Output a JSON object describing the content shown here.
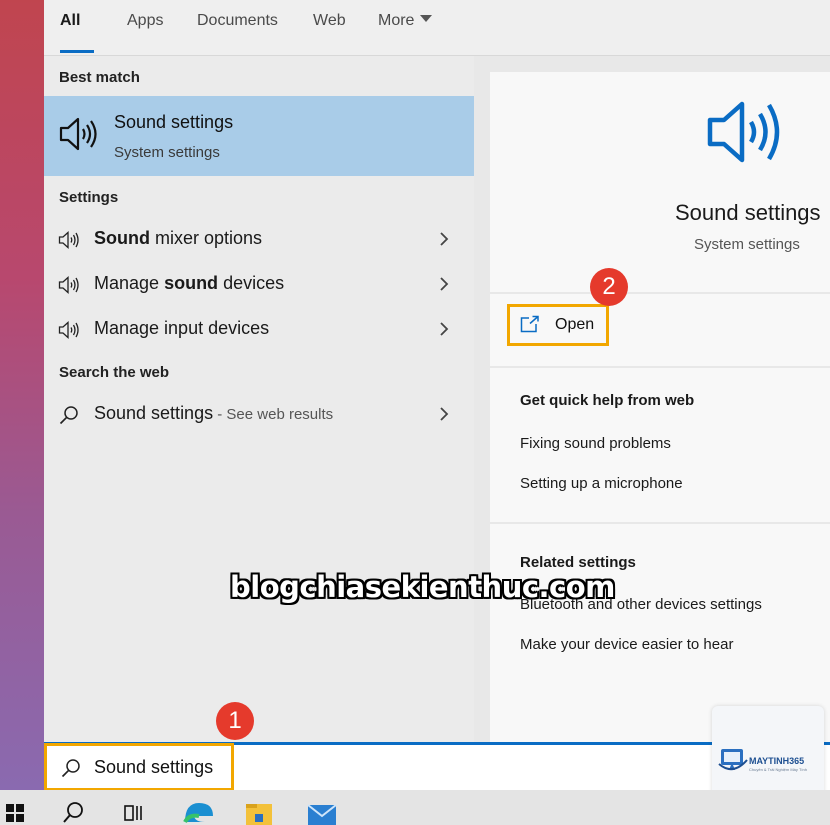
{
  "tabs": [
    {
      "label": "All",
      "active": true
    },
    {
      "label": "Apps"
    },
    {
      "label": "Documents"
    },
    {
      "label": "Web"
    },
    {
      "label": "More"
    }
  ],
  "left": {
    "best_match_label": "Best match",
    "best_match": {
      "title": "Sound settings",
      "subtitle": "System settings",
      "icon": "speaker-icon"
    },
    "settings_label": "Settings",
    "settings_items": [
      {
        "pre": "",
        "bold": "Sound",
        "post": " mixer options",
        "icon": "speaker-icon"
      },
      {
        "pre": "Manage ",
        "bold": "sound",
        "post": " devices",
        "icon": "speaker-icon"
      },
      {
        "pre": "Manage input devices",
        "bold": "",
        "post": "",
        "icon": "speaker-icon"
      }
    ],
    "web_label": "Search the web",
    "web_item": {
      "label": "Sound settings",
      "note": " - See web results",
      "icon": "search-icon"
    }
  },
  "right": {
    "title": "Sound settings",
    "subtitle": "System settings",
    "open_label": "Open",
    "quick_help": {
      "title": "Get quick help from web",
      "links": [
        "Fixing sound problems",
        "Setting up a microphone"
      ]
    },
    "related": {
      "title": "Related settings",
      "links": [
        "Bluetooth and other devices settings",
        "Make your device easier to hear"
      ]
    }
  },
  "search": {
    "value": "Sound settings"
  },
  "badges": [
    "1",
    "2"
  ],
  "watermark": "blogchiasekienthuc.com",
  "logo": {
    "text": "MAYTINH365",
    "tagline": "Chuyên & Trải Nghiệm Máy Tính"
  },
  "colors": {
    "accent": "#0a6cc4",
    "highlight": "#a9cce8",
    "callout": "#f2a700",
    "badge": "#e53a2c"
  }
}
